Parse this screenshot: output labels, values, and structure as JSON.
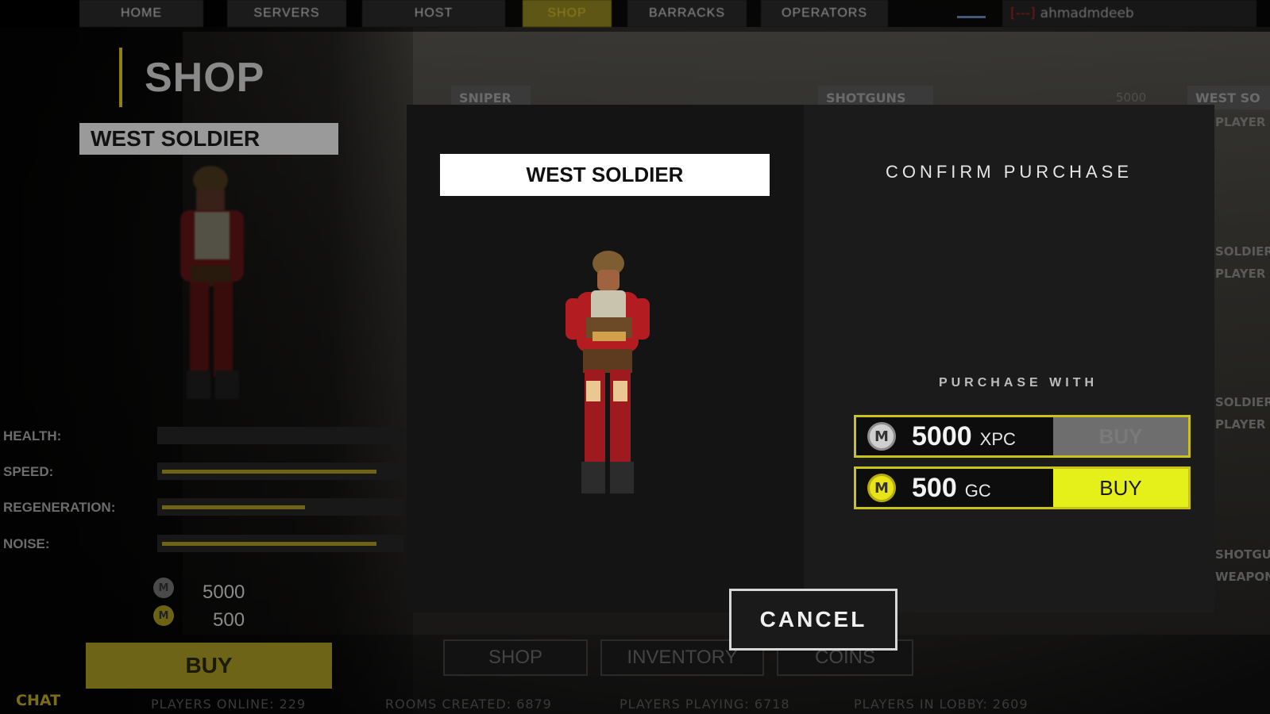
{
  "nav": {
    "tabs": [
      {
        "label": "HOME",
        "active": false
      },
      {
        "label": "SERVERS",
        "active": false
      },
      {
        "label": "HOST",
        "active": false
      },
      {
        "label": "SHOP",
        "active": true
      },
      {
        "label": "BARRACKS",
        "active": false
      },
      {
        "label": "OPERATORS",
        "active": false
      }
    ],
    "user_tag": "[---]",
    "username": "ahmadmdeeb"
  },
  "shop": {
    "title": "SHOP",
    "item_name": "WEST SOLDIER",
    "cards": [
      {
        "label": "SNIPER"
      },
      {
        "label": "SHOTGUNS"
      },
      {
        "label": "WEST SO"
      }
    ],
    "card_price": "5000",
    "right_stubs": [
      "PLAYER S",
      "SOLDIER",
      "PLAYER S",
      "SOLDIER",
      "PLAYER S",
      "SHOTGU",
      "WEAPON"
    ],
    "stats": [
      {
        "label": "HEALTH:",
        "level": 0.0
      },
      {
        "label": "SPEED:",
        "level": 0.9
      },
      {
        "label": "REGENERATION:",
        "level": 0.6
      },
      {
        "label": "NOISE:",
        "level": 0.9
      }
    ],
    "price_xpc": "5000",
    "price_gc": "500",
    "buy_label": "BUY",
    "chat_label": "CHAT",
    "bottom_tabs": [
      "SHOP",
      "INVENTORY",
      "COINS"
    ],
    "footer": {
      "players_online": "PLAYERS ONLINE: 229",
      "rooms_created": "ROOMS CREATED: 6879",
      "players_playing": "PLAYERS PLAYING: 6718",
      "players_in_lobby": "PLAYERS IN LOBBY: 2609"
    },
    "colors": {
      "accent": "#e5f01a",
      "dim_accent": "#6e6417"
    }
  },
  "dialog": {
    "item_name": "WEST SOLDIER",
    "title": "CONFIRM PURCHASE",
    "purchase_with": "PURCHASE WITH",
    "options": [
      {
        "coin_icon": "M",
        "amount": "5000",
        "unit": "XPC",
        "buy_label": "BUY",
        "enabled": false
      },
      {
        "coin_icon": "M",
        "amount": "500",
        "unit": "GC",
        "buy_label": "BUY",
        "enabled": true
      }
    ],
    "cancel_label": "CANCEL"
  }
}
